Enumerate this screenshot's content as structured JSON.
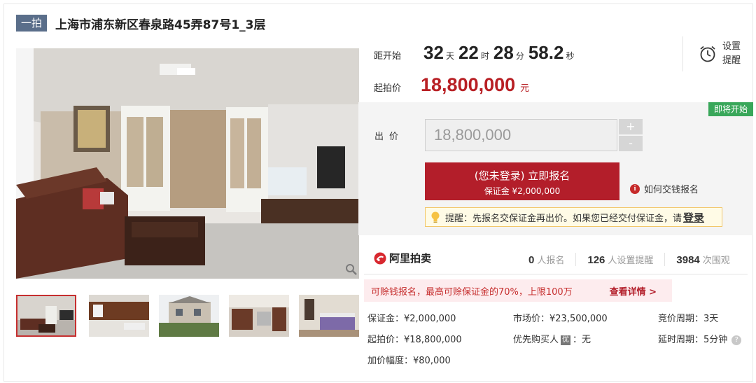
{
  "header": {
    "tag": "一拍",
    "title": "上海市浦东新区春泉路45弄87号1_3层"
  },
  "countdown": {
    "label": "距开始",
    "days": "32",
    "days_unit": "天",
    "hours": "22",
    "hours_unit": "时",
    "minutes": "28",
    "minutes_unit": "分",
    "seconds": "58.2",
    "seconds_unit": "秒"
  },
  "reminder": {
    "label": "设置提醒",
    "icon": "alarm-clock-icon"
  },
  "start_price": {
    "label": "起拍价",
    "value": "18,800,000",
    "unit": "元"
  },
  "bid": {
    "status_badge": "即将开始",
    "label": "出价",
    "input_value": "18,800,000",
    "plus": "+",
    "minus": "-",
    "signup_main": "(您未登录) 立即报名",
    "signup_sub": "保证金 ¥2,000,000",
    "howto": "如何交钱报名",
    "tip_text": "提醒：先报名交保证金再出价。如果您已经交付保证金，请",
    "tip_login": "登录"
  },
  "brand": {
    "name": "阿里拍卖"
  },
  "stats": [
    {
      "num": "0",
      "label": "人报名"
    },
    {
      "num": "126",
      "label": "人设置提醒"
    },
    {
      "num": "3984",
      "label": "次围观"
    }
  ],
  "promo": {
    "text": "可赊钱报名，最高可赊保证金的70%，上限100万",
    "link": "查看详情 >"
  },
  "info": {
    "deposit": "保证金：¥2,000,000",
    "market_price": "市场价：¥23,500,000",
    "bid_period": "竞价周期：3天",
    "start_price": "起拍价：¥18,800,000",
    "priority_label": "优先购买人",
    "priority_badge": "优",
    "priority_value": "：无",
    "delay_period": "延时周期：5分钟",
    "increment": "加价幅度：¥80,000"
  },
  "colors": {
    "accent_red": "#b31e2a",
    "tag_blue": "#5a6e8a",
    "badge_green": "#39a75a"
  }
}
